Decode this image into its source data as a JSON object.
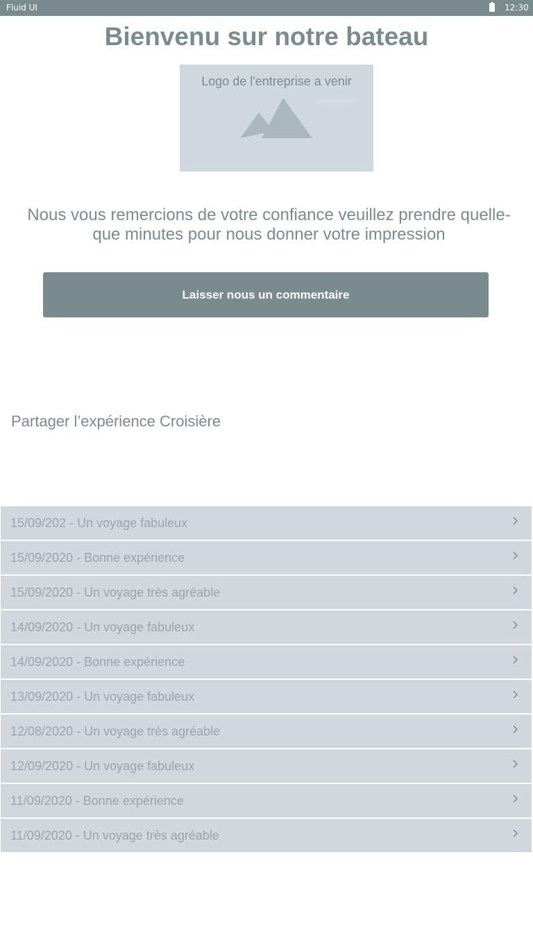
{
  "status_bar": {
    "app_name": "Fluid UI",
    "time": "12:30",
    "icon": "battery-icon"
  },
  "header": {
    "title": "Bienvenu sur notre bateau"
  },
  "logo": {
    "caption": "Logo de l'entreprise a venir",
    "icon": "mountain-image-icon",
    "background": "#cfd8de",
    "icon_color": "#aab8be"
  },
  "intro": {
    "text": "Nous vous remercions de votre confiance veuillez prendre quelle-que minutes pour nous donner votre impression"
  },
  "comment_button": {
    "label": "Laisser nous un commentaire"
  },
  "share_section": {
    "title": "Partager l’expérience Croisière"
  },
  "reviews": {
    "chevron_icon": "chevron-right-icon",
    "items": [
      {
        "label": "15/09/202 - Un voyage fabuleux"
      },
      {
        "label": "15/09/2020 - Bonne expérience"
      },
      {
        "label": "15/09/2020 - Un voyage très agréable"
      },
      {
        "label": "14/09/2020 - Un voyage fabuleux"
      },
      {
        "label": "14/09/2020 - Bonne expérience"
      },
      {
        "label": "13/09/2020 - Un voyage fabuleux"
      },
      {
        "label": "12/08/2020 - Un voyage très agréable"
      },
      {
        "label": "12/09/2020 - Un voyage fabuleux"
      },
      {
        "label": "11/09/2020 - Bonne expérience"
      },
      {
        "label": "11/09/2020 - Un voyage très agréable"
      }
    ]
  },
  "colors": {
    "primary": "#7a8b8e",
    "list_background": "#d0d8de",
    "list_text": "#9aa5aa",
    "background": "#ffffff"
  }
}
